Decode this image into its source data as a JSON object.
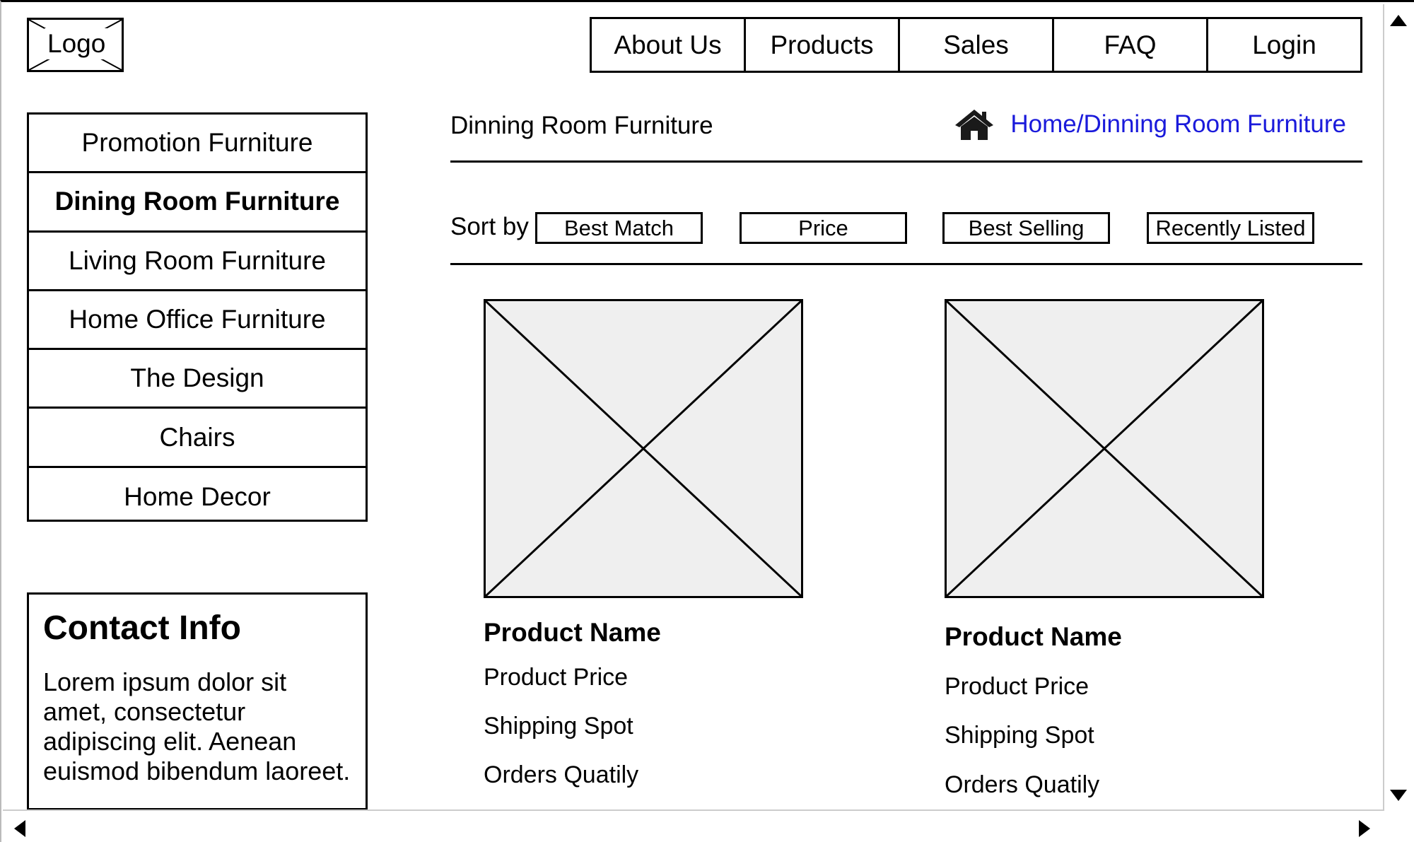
{
  "header": {
    "logo_label": "Logo",
    "nav": [
      "About Us",
      "Products",
      "Sales",
      "FAQ",
      "Login"
    ]
  },
  "sidebar": {
    "categories": [
      {
        "label": "Promotion Furniture",
        "active": false
      },
      {
        "label": "Dining Room Furniture",
        "active": true
      },
      {
        "label": "Living Room Furniture",
        "active": false
      },
      {
        "label": "Home Office Furniture",
        "active": false
      },
      {
        "label": "The Design",
        "active": false
      },
      {
        "label": "Chairs",
        "active": false
      },
      {
        "label": "Home Decor",
        "active": false
      }
    ],
    "contact": {
      "title": "Contact Info",
      "text": "Lorem ipsum dolor sit amet, consectetur adipiscing elit. Aenean euismod bibendum laoreet."
    }
  },
  "main": {
    "page_title": "Dinning Room Furniture",
    "breadcrumb": "Home/Dinning Room Furniture",
    "sort": {
      "label": "Sort by",
      "options": [
        "Best Match",
        "Price",
        "Best Selling",
        "Recently Listed"
      ]
    },
    "products": [
      {
        "name": "Product Name",
        "price": "Product Price",
        "shipping": "Shipping Spot",
        "orders": "Orders Quatily"
      },
      {
        "name": "Product Name",
        "price": "Product Price",
        "shipping": "Shipping Spot",
        "orders": "Orders Quatily"
      }
    ]
  },
  "colors": {
    "link": "#1a1adb",
    "placeholder_fill": "#efefef"
  },
  "icons": [
    "home-icon",
    "scroll-up-arrow",
    "scroll-down-arrow",
    "scroll-left-arrow",
    "scroll-right-arrow"
  ]
}
